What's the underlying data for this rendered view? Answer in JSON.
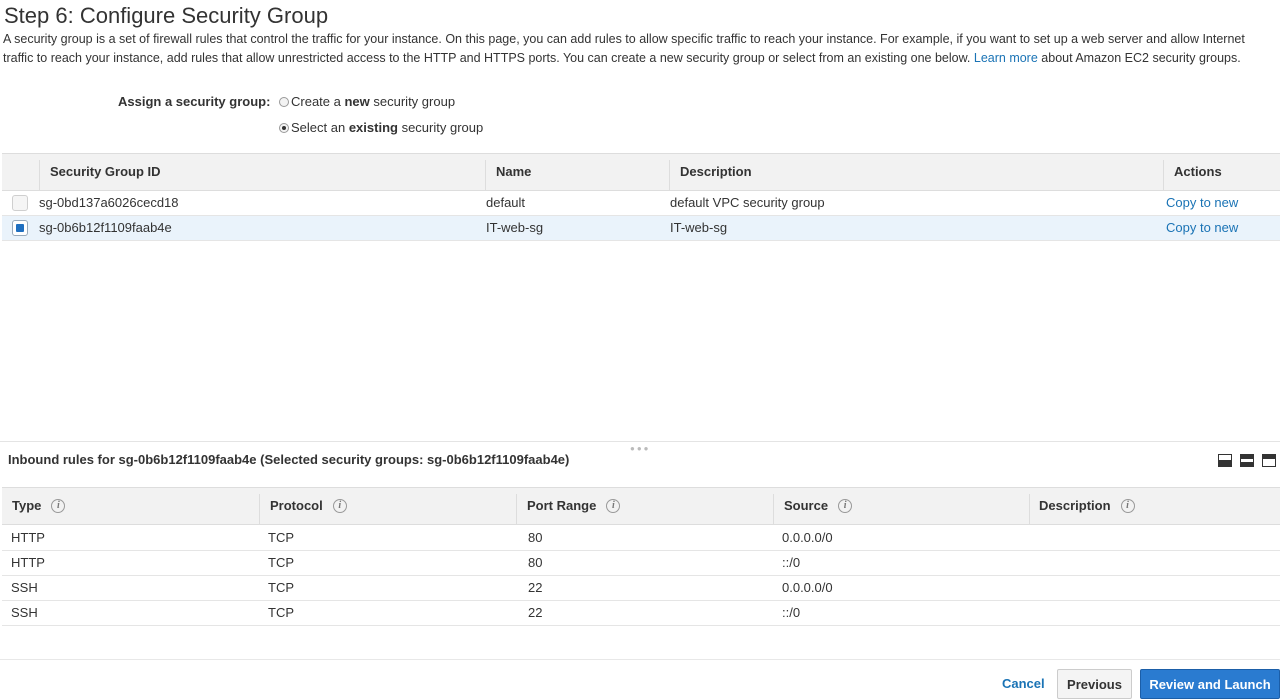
{
  "page": {
    "title": "Step 6: Configure Security Group",
    "intro_before_link": "A security group is a set of firewall rules that control the traffic for your instance. On this page, you can add rules to allow specific traffic to reach your instance. For example, if you want to set up a web server and allow Internet traffic to reach your instance, add rules that allow unrestricted access to the HTTP and HTTPS ports. You can create a new security group or select from an existing one below. ",
    "intro_link": "Learn more",
    "intro_after_link": " about Amazon EC2 security groups."
  },
  "assign": {
    "label": "Assign a security group:",
    "options": [
      {
        "prefix": "Create a ",
        "bold": "new",
        "suffix": " security group",
        "selected": false
      },
      {
        "prefix": "Select an ",
        "bold": "existing",
        "suffix": " security group",
        "selected": true
      }
    ]
  },
  "security_groups": {
    "columns": [
      "Security Group ID",
      "Name",
      "Description",
      "Actions"
    ],
    "rows": [
      {
        "id": "sg-0bd137a6026cecd18",
        "name": "default",
        "description": "default VPC security group",
        "action": "Copy to new",
        "selected": false
      },
      {
        "id": "sg-0b6b12f1109faab4e",
        "name": "IT-web-sg",
        "description": "IT-web-sg",
        "action": "Copy to new",
        "selected": true
      }
    ]
  },
  "inbound": {
    "title": "Inbound rules for sg-0b6b12f1109faab4e (Selected security groups: sg-0b6b12f1109faab4e)",
    "info_glyph": "i",
    "columns": [
      "Type",
      "Protocol",
      "Port Range",
      "Source",
      "Description"
    ],
    "rows": [
      {
        "type": "HTTP",
        "protocol": "TCP",
        "port": "80",
        "source": "0.0.0.0/0",
        "description": ""
      },
      {
        "type": "HTTP",
        "protocol": "TCP",
        "port": "80",
        "source": "::/0",
        "description": ""
      },
      {
        "type": "SSH",
        "protocol": "TCP",
        "port": "22",
        "source": "0.0.0.0/0",
        "description": ""
      },
      {
        "type": "SSH",
        "protocol": "TCP",
        "port": "22",
        "source": "::/0",
        "description": ""
      }
    ]
  },
  "footer": {
    "cancel": "Cancel",
    "previous": "Previous",
    "review_launch": "Review and Launch"
  },
  "colors": {
    "link": "#1a73b5",
    "primary_button": "#2a7bd0",
    "selected_row": "#eaf3fb",
    "header_bg": "#f2f2f2"
  }
}
